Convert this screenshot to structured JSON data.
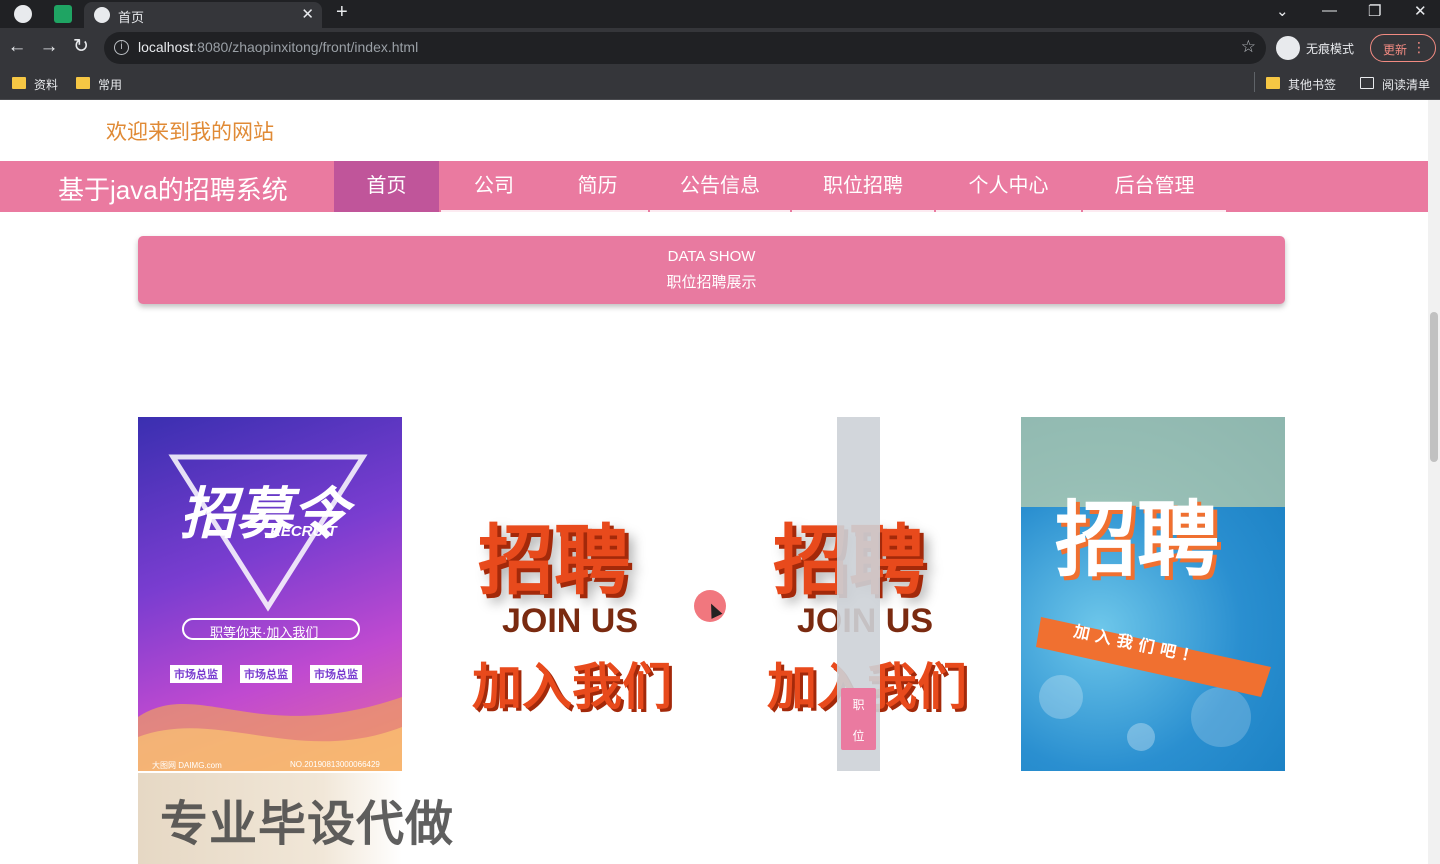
{
  "browser": {
    "tab_title": "首页",
    "close_glyph": "✕",
    "new_tab_glyph": "+",
    "url_host": "localhost",
    "url_rest": ":8080/zhaopinxitong/front/index.html",
    "incognito_label": "无痕模式",
    "update_label": "更新",
    "bookmarks": [
      "资料",
      "常用"
    ],
    "other_bookmarks": "其他书签",
    "reading_list": "阅读清单"
  },
  "site": {
    "welcome": "欢迎来到我的网站",
    "brand": "基于java的招聘系统",
    "nav": [
      "首页",
      "公司",
      "简历",
      "公告信息",
      "职位招聘",
      "个人中心",
      "后台管理"
    ]
  },
  "banner": {
    "line1": "DATA SHOW",
    "line2": "职位招聘展示"
  },
  "cards": {
    "card1_title": "招募令",
    "card1_sub": "RECRUIT",
    "card1_slogan": "职等你来·加入我们",
    "card1_tags": [
      "市场总监",
      "市场总监",
      "市场总监"
    ],
    "card1_footer_left": "大图网 DAIMG.com",
    "card1_footer_right": "NO.20190813000066429",
    "card2_big": "招聘",
    "card2_join": "JOIN US",
    "card2_cn": "加入我们",
    "card4_big": "招聘",
    "card4_sub": "加入我们吧！"
  },
  "slider_tag": [
    "职",
    "位"
  ],
  "overlay_text": "专业毕设代做",
  "colors": {
    "nav_bg": "#ea7aa0",
    "nav_active": "#c0559a",
    "welcome": "#e08a35"
  }
}
